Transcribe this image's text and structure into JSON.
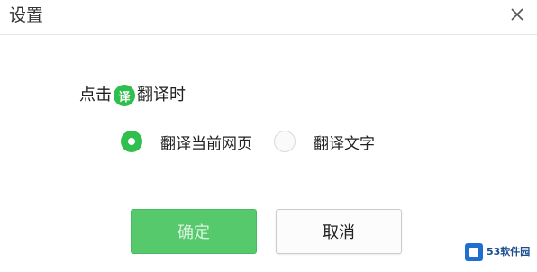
{
  "window": {
    "title": "设置",
    "close_icon": "close-icon"
  },
  "prompt": {
    "before": "点击",
    "badge": "译",
    "after": "翻译时"
  },
  "options": [
    {
      "label": "翻译当前网页",
      "selected": true
    },
    {
      "label": "翻译文字",
      "selected": false
    }
  ],
  "buttons": {
    "ok": "确定",
    "cancel": "取消"
  },
  "watermark": {
    "text": "53软件园"
  },
  "colors": {
    "accent": "#2fbf4e",
    "ok_button": "#55c96b"
  }
}
